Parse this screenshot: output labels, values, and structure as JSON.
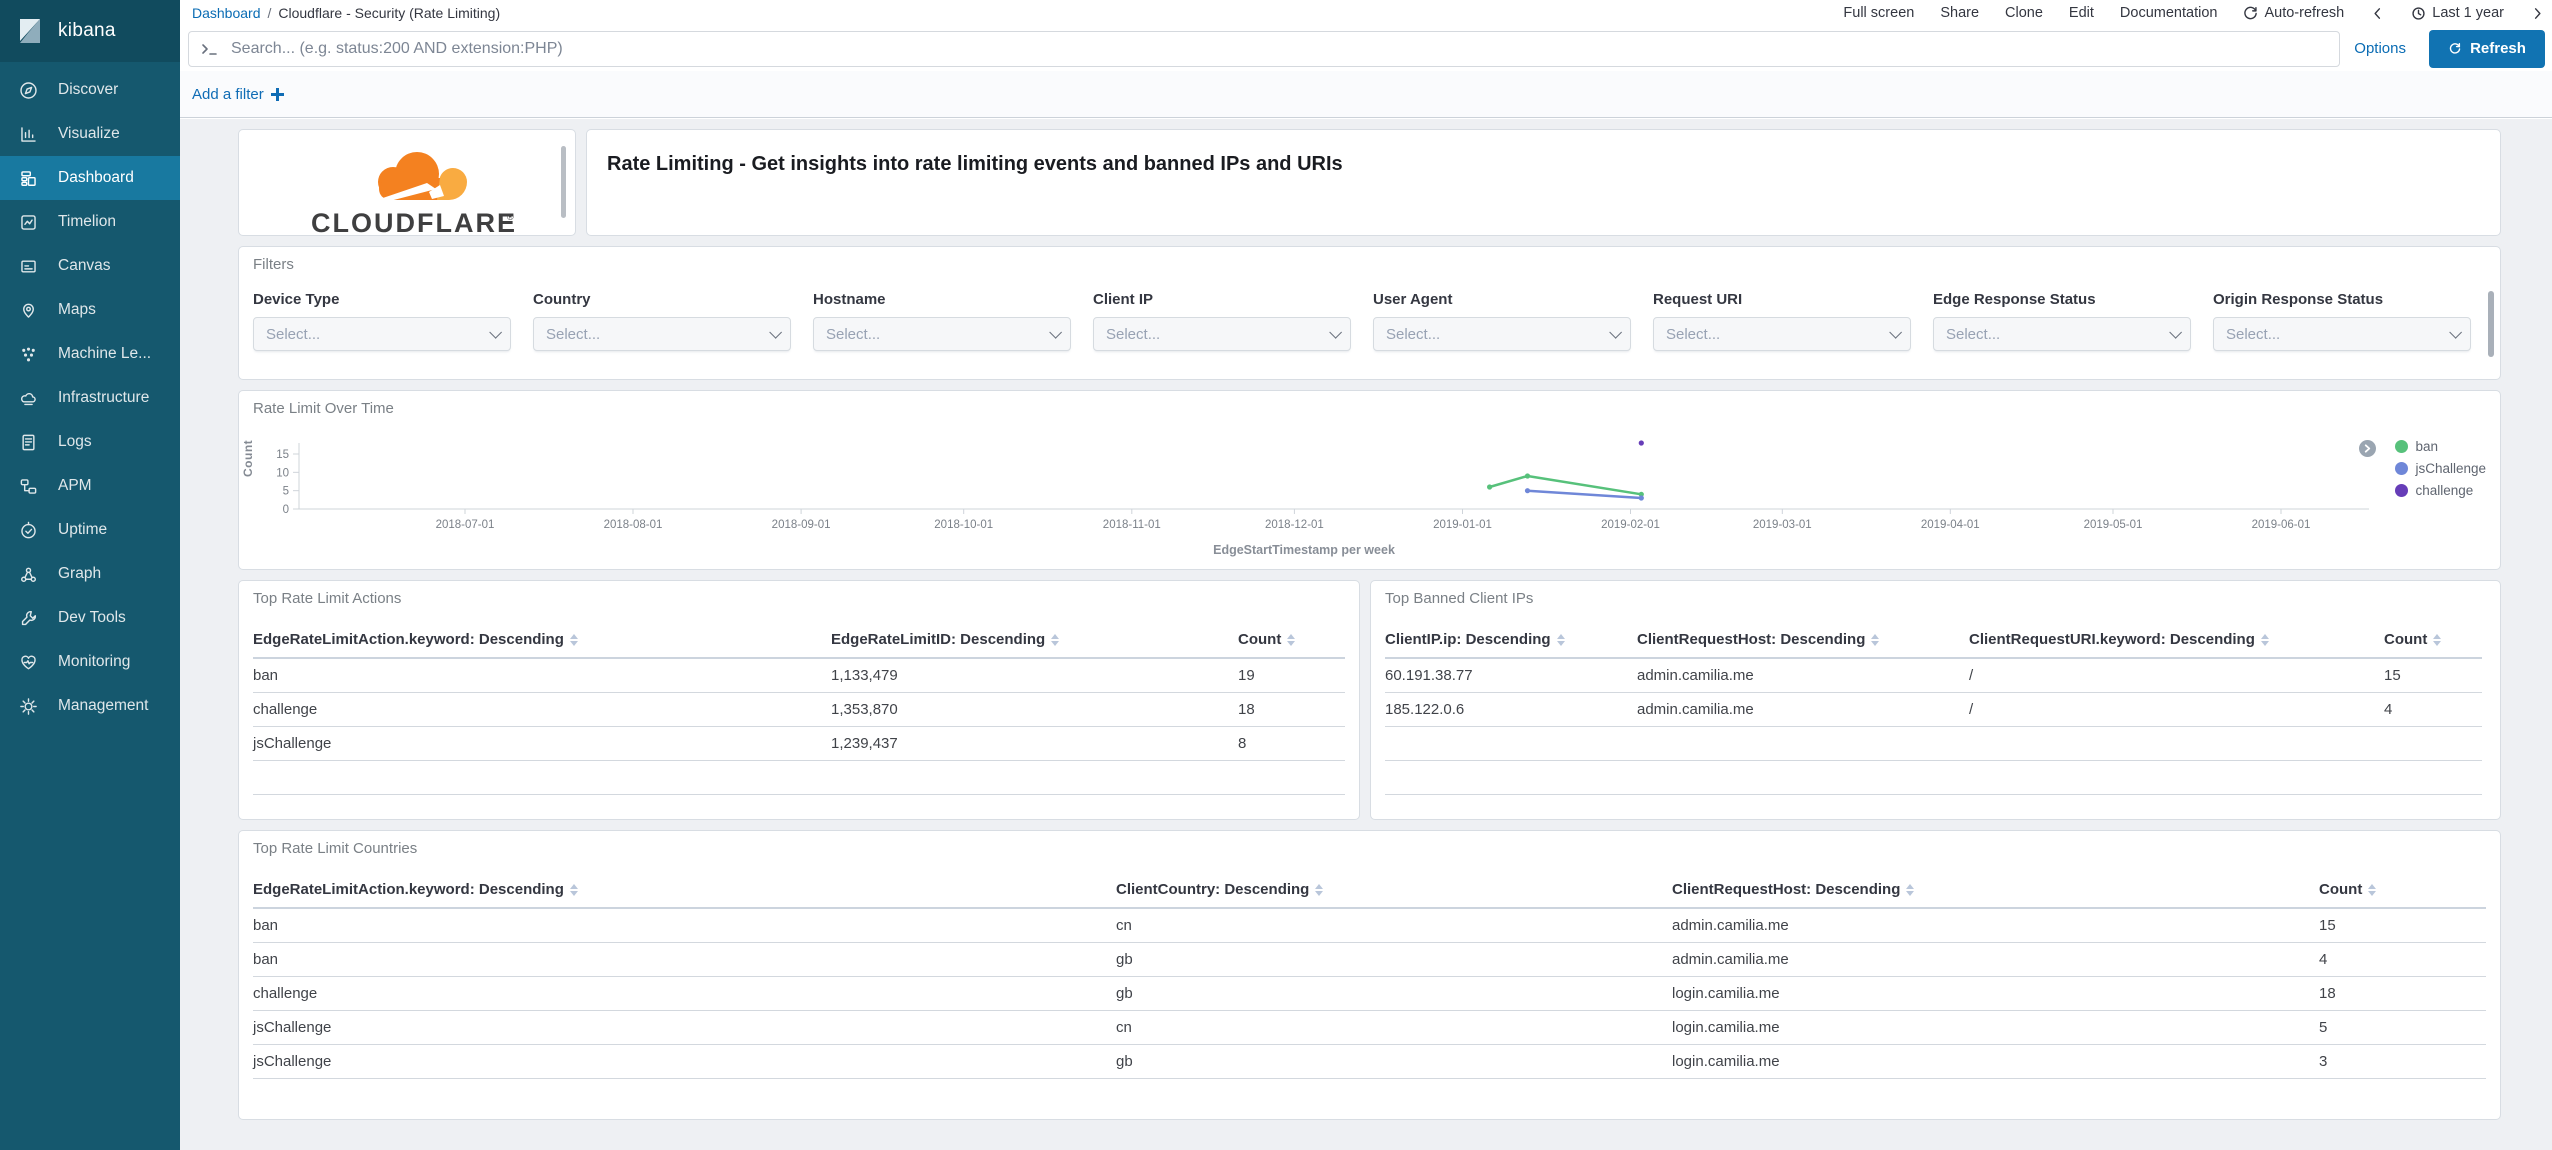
{
  "app": {
    "name": "kibana"
  },
  "colors": {
    "accent_blue": "#0f72b1",
    "sidebar": "#15586e",
    "sidebar_active": "#1879a0",
    "cloudflare_orange": "#f48120",
    "cloudflare_light_orange": "#f9ab41"
  },
  "sidebar": {
    "logo": "kibana",
    "items": [
      {
        "label": "Discover"
      },
      {
        "label": "Visualize"
      },
      {
        "label": "Dashboard",
        "active": true
      },
      {
        "label": "Timelion"
      },
      {
        "label": "Canvas"
      },
      {
        "label": "Maps"
      },
      {
        "label": "Machine Le..."
      },
      {
        "label": "Infrastructure"
      },
      {
        "label": "Logs"
      },
      {
        "label": "APM"
      },
      {
        "label": "Uptime"
      },
      {
        "label": "Graph"
      },
      {
        "label": "Dev Tools"
      },
      {
        "label": "Monitoring"
      },
      {
        "label": "Management"
      }
    ]
  },
  "header": {
    "breadcrumb": {
      "link": "Dashboard",
      "separator": "/",
      "current": "Cloudflare - Security (Rate Limiting)"
    },
    "menu": [
      "Full screen",
      "Share",
      "Clone",
      "Edit",
      "Documentation"
    ],
    "auto_refresh_label": "Auto-refresh",
    "time_range": "Last 1 year"
  },
  "search": {
    "placeholder": "Search... (e.g. status:200 AND extension:PHP)",
    "options_label": "Options",
    "refresh_label": "Refresh"
  },
  "filter_bar": {
    "add_label": "Add a filter"
  },
  "panels": {
    "logo": {
      "brand": "CLOUDFLARE"
    },
    "description": {
      "text": "Rate Limiting - Get insights into rate limiting events and banned IPs and URIs"
    },
    "filters": {
      "title": "Filters",
      "select_placeholder": "Select...",
      "items": [
        "Device Type",
        "Country",
        "Hostname",
        "Client IP",
        "User Agent",
        "Request URI",
        "Edge Response Status",
        "Origin Response Status"
      ]
    },
    "chart": {
      "title": "Rate Limit Over Time"
    },
    "actions_table": {
      "title": "Top Rate Limit Actions",
      "columns": [
        "EdgeRateLimitAction.keyword: Descending",
        "EdgeRateLimitID: Descending",
        "Count"
      ],
      "rows": [
        [
          "ban",
          "1,133,479",
          "19"
        ],
        [
          "challenge",
          "1,353,870",
          "18"
        ],
        [
          "jsChallenge",
          "1,239,437",
          "8"
        ]
      ]
    },
    "banned_table": {
      "title": "Top Banned Client IPs",
      "columns": [
        "ClientIP.ip: Descending",
        "ClientRequestHost: Descending",
        "ClientRequestURI.keyword: Descending",
        "Count"
      ],
      "rows": [
        [
          "60.191.38.77",
          "admin.camilia.me",
          "/",
          "15"
        ],
        [
          "185.122.0.6",
          "admin.camilia.me",
          "/",
          "4"
        ]
      ]
    },
    "countries_table": {
      "title": "Top Rate Limit Countries",
      "columns": [
        "EdgeRateLimitAction.keyword: Descending",
        "ClientCountry: Descending",
        "ClientRequestHost: Descending",
        "Count"
      ],
      "rows": [
        [
          "ban",
          "cn",
          "admin.camilia.me",
          "15"
        ],
        [
          "ban",
          "gb",
          "admin.camilia.me",
          "4"
        ],
        [
          "challenge",
          "gb",
          "login.camilia.me",
          "18"
        ],
        [
          "jsChallenge",
          "cn",
          "login.camilia.me",
          "5"
        ],
        [
          "jsChallenge",
          "gb",
          "login.camilia.me",
          "3"
        ]
      ]
    }
  },
  "chart_data": {
    "type": "line",
    "title": "Rate Limit Over Time",
    "xlabel": "EdgeStartTimestamp per week",
    "ylabel": "Count",
    "x_range": [
      "2018-07-01",
      "2019-06-17"
    ],
    "x_ticks": [
      "2018-07-01",
      "2018-08-01",
      "2018-09-01",
      "2018-10-01",
      "2018-11-01",
      "2018-12-01",
      "2019-01-01",
      "2019-02-01",
      "2019-03-01",
      "2019-04-01",
      "2019-05-01",
      "2019-06-01"
    ],
    "y_ticks": [
      0,
      5,
      10,
      15
    ],
    "ylim": [
      0,
      20
    ],
    "grid": false,
    "legend_position": "right",
    "series": [
      {
        "name": "ban",
        "color": "#57c17b",
        "points": [
          [
            "2019-01-06",
            6
          ],
          [
            "2019-01-13",
            9
          ],
          [
            "2019-02-03",
            4
          ]
        ]
      },
      {
        "name": "jsChallenge",
        "color": "#6f87d8",
        "points": [
          [
            "2019-01-13",
            5
          ],
          [
            "2019-02-03",
            3
          ]
        ]
      },
      {
        "name": "challenge",
        "color": "#663db8",
        "points": [
          [
            "2019-02-03",
            18
          ]
        ]
      }
    ]
  }
}
